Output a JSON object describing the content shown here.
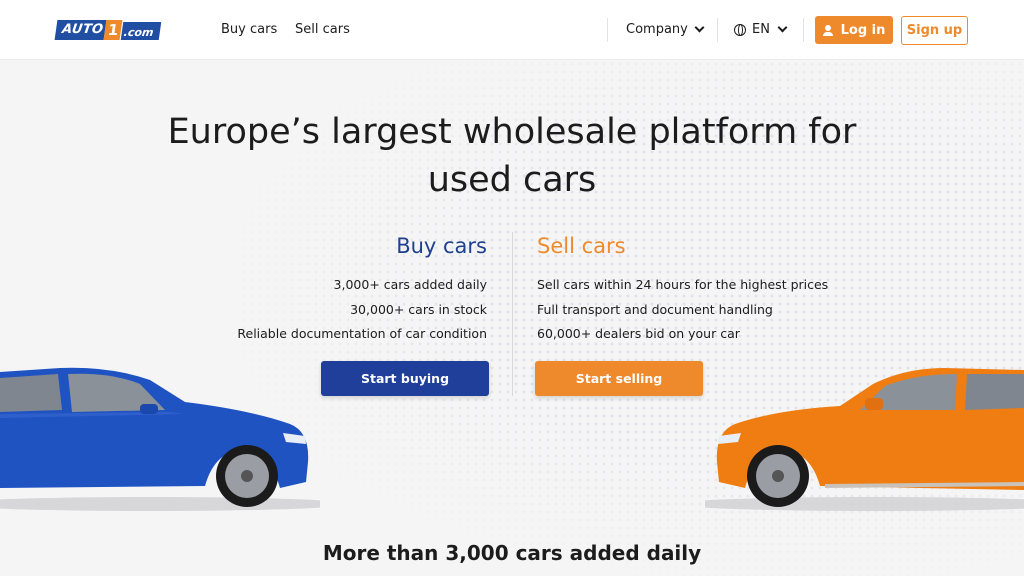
{
  "header": {
    "logo": {
      "part1": "AUTO",
      "part2": "1",
      "part3": ".com"
    },
    "nav": [
      {
        "label": "Buy cars"
      },
      {
        "label": "Sell cars"
      }
    ],
    "company_label": "Company",
    "language_label": "EN",
    "login_label": "Log in",
    "signup_label": "Sign up"
  },
  "hero": {
    "title_line1": "Europe’s largest wholesale platform for",
    "title_line2": "used cars"
  },
  "buy": {
    "title": "Buy cars",
    "features": [
      "3,000+ cars added daily",
      "30,000+ cars in stock",
      "Reliable documentation of car condition"
    ],
    "button_label": "Start buying",
    "car_color": "#1f53c2"
  },
  "sell": {
    "title": "Sell cars",
    "features": [
      "Sell cars within 24 hours for the highest prices",
      "Full transport and document handling",
      "60,000+ dealers bid on your car"
    ],
    "button_label": "Start selling",
    "car_color": "#ef7d12"
  },
  "bottom": {
    "title": "More than 3,000 cars added daily"
  },
  "colors": {
    "brand_blue": "#1f3f9a",
    "brand_orange": "#ef8a2c"
  }
}
